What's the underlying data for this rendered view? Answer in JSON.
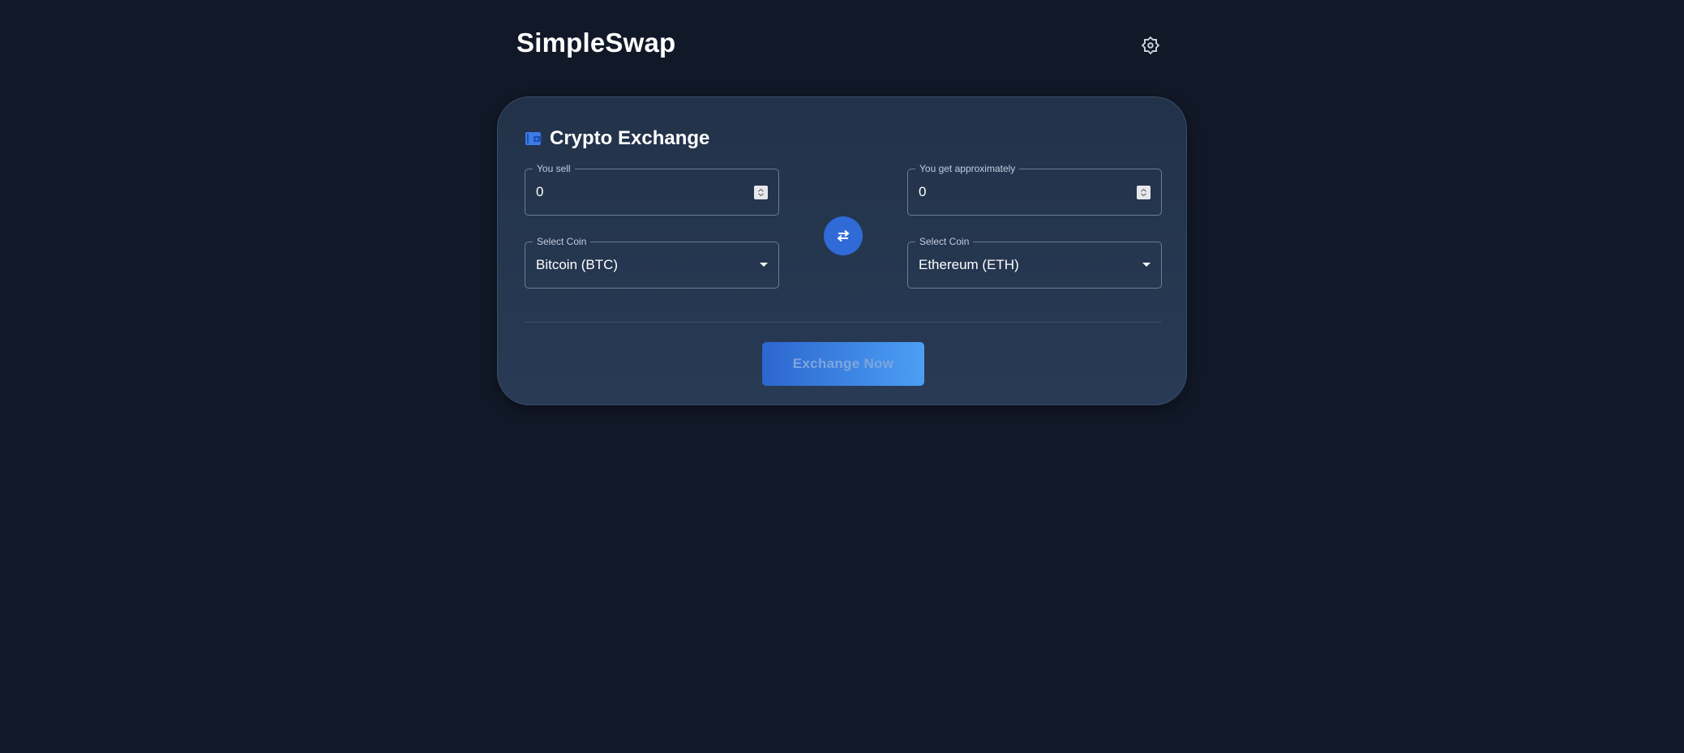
{
  "app": {
    "title": "SimpleSwap",
    "settings_icon": "gear-icon"
  },
  "card": {
    "title": "Crypto Exchange",
    "icon": "wallet-icon"
  },
  "sell": {
    "label": "You sell",
    "value": "0",
    "coin_label": "Select Coin",
    "coin": "Bitcoin (BTC)"
  },
  "receive": {
    "label": "You get approximately",
    "value": "0",
    "coin_label": "Select Coin",
    "coin": "Ethereum (ETH)"
  },
  "swap": {
    "icon": "swap-arrows-icon"
  },
  "actions": {
    "exchange_label": "Exchange Now"
  },
  "colors": {
    "background": "#111827",
    "card": "#243550",
    "accent": "#2f6ad6",
    "accent_light": "#4b9ff4"
  }
}
